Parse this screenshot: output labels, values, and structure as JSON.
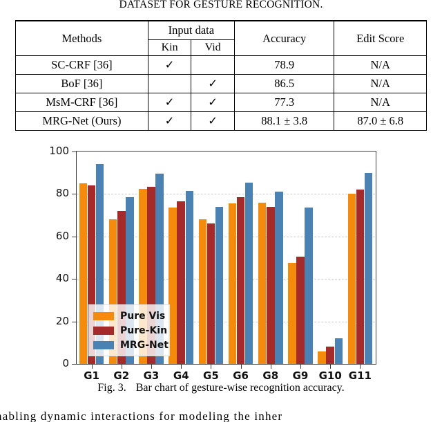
{
  "table": {
    "caption": "DATASET FOR GESTURE RECOGNITION.",
    "headers": {
      "methods": "Methods",
      "input_data": "Input data",
      "kin": "Kin",
      "vid": "Vid",
      "accuracy": "Accuracy",
      "edit_score": "Edit Score"
    },
    "rows": [
      {
        "method": "SC-CRF [36]",
        "kin": "✓",
        "vid": "",
        "accuracy": "78.9",
        "edit": "N/A",
        "bold": false
      },
      {
        "method": "BoF [36]",
        "kin": "",
        "vid": "✓",
        "accuracy": "86.5",
        "edit": "N/A",
        "bold": false
      },
      {
        "method": "MsM-CRF [36]",
        "kin": "✓",
        "vid": "✓",
        "accuracy": "77.3",
        "edit": "N/A",
        "bold": false
      },
      {
        "method": "MRG-Net (Ours)",
        "kin": "✓",
        "vid": "✓",
        "accuracy": "88.1 ± 3.8",
        "edit": "87.0 ± 6.8",
        "bold": true
      }
    ]
  },
  "figure": {
    "number": "Fig. 3.",
    "caption": "Bar chart of gesture-wise recognition accuracy."
  },
  "body_text": {
    "clipped_line": "nabling  dynamic  interactions  for  modeling  the  inher"
  },
  "chart_data": {
    "type": "bar",
    "title": "",
    "xlabel": "",
    "ylabel": "",
    "ylim": [
      0,
      100
    ],
    "yticks": [
      0,
      20,
      40,
      60,
      80,
      100
    ],
    "grid": true,
    "legend_position": "lower left",
    "categories": [
      "G1",
      "G2",
      "G3",
      "G4",
      "G5",
      "G6",
      "G8",
      "G9",
      "G10",
      "G11"
    ],
    "series": [
      {
        "name": "Pure Vis",
        "color": "#f58b0c",
        "values": [
          85.0,
          68.0,
          82.5,
          73.5,
          68.0,
          75.5,
          76.0,
          47.5,
          6.0,
          80.0
        ]
      },
      {
        "name": "Pure-Kin",
        "color": "#a52a2a",
        "values": [
          84.0,
          72.0,
          83.5,
          76.5,
          66.0,
          78.5,
          74.0,
          50.5,
          8.0,
          82.0
        ]
      },
      {
        "name": "MRG-Net",
        "color": "#4a82b4",
        "values": [
          94.0,
          78.5,
          89.5,
          81.5,
          74.0,
          85.5,
          81.0,
          73.5,
          12.0,
          90.0
        ]
      }
    ]
  }
}
